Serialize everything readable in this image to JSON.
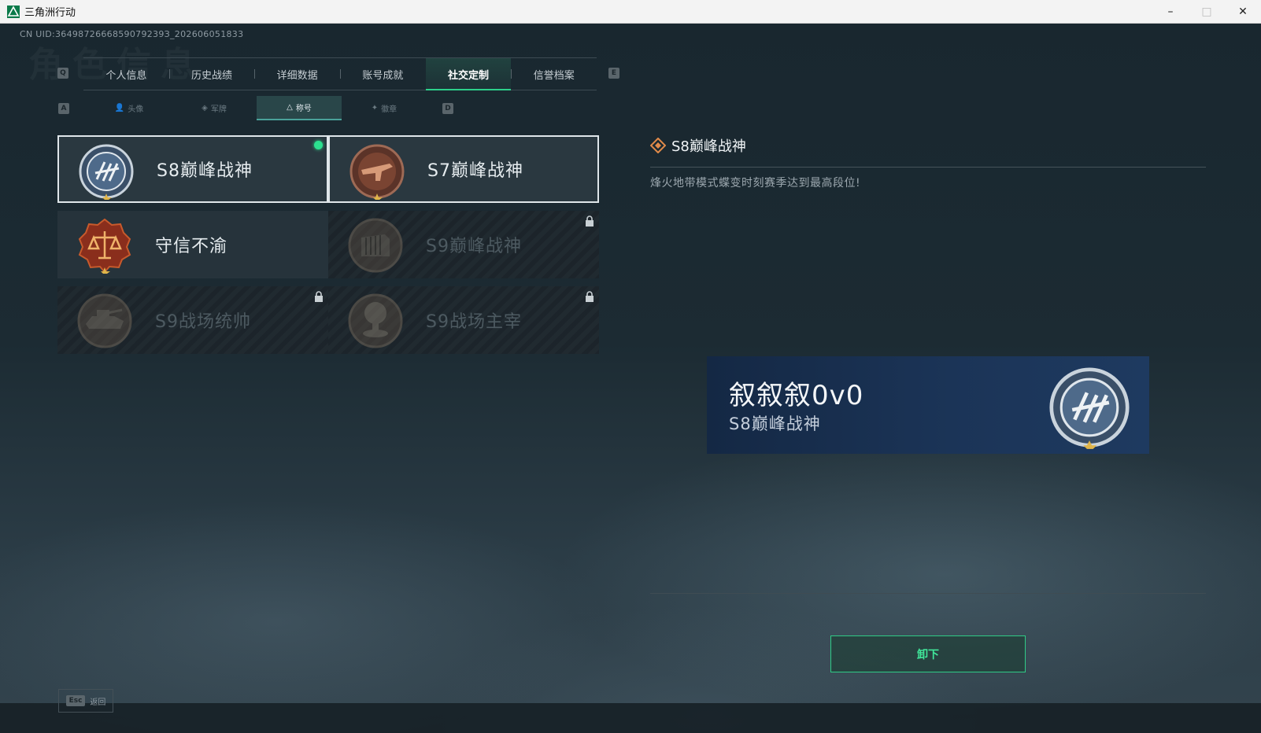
{
  "window": {
    "title": "三角洲行动",
    "min_glyph": "–",
    "max_glyph": "□",
    "close_glyph": "✕"
  },
  "uid": "CN UID:3649872666859079239З_202606051833",
  "page_watermark": "角色信息",
  "keys": {
    "tab_prev": "Q",
    "tab_next": "E",
    "sub_prev": "A",
    "sub_next": "D"
  },
  "tabs": [
    {
      "label": "个人信息"
    },
    {
      "label": "历史战绩"
    },
    {
      "label": "详细数据"
    },
    {
      "label": "账号成就"
    },
    {
      "label": "社交定制",
      "active": true
    },
    {
      "label": "信誉档案"
    }
  ],
  "subtabs": [
    {
      "label": "头像",
      "icon": "person-icon"
    },
    {
      "label": "军牌",
      "icon": "dogtag-icon"
    },
    {
      "label": "称号",
      "icon": "title-icon",
      "active": true
    },
    {
      "label": "徽章",
      "icon": "badge-icon"
    }
  ],
  "titles": [
    {
      "label": "S8巅峰战神",
      "emblem": "s8-emblem-icon",
      "state": "equipped"
    },
    {
      "label": "S7巅峰战神",
      "emblem": "s7-emblem-icon",
      "state": "selected"
    },
    {
      "label": "守信不渝",
      "emblem": "scales-emblem-icon",
      "state": "owned"
    },
    {
      "label": "S9巅峰战神",
      "emblem": "s9-emblem-icon",
      "state": "locked"
    },
    {
      "label": "S9战场统帅",
      "emblem": "tank-emblem-icon",
      "state": "locked"
    },
    {
      "label": "S9战场主宰",
      "emblem": "explosion-emblem-icon",
      "state": "locked"
    }
  ],
  "detail": {
    "title": "S8巅峰战神",
    "description": "烽火地带模式蝶变时刻赛季达到最高段位!"
  },
  "namecard": {
    "player_name": "叙叙叙0v0",
    "title": "S8巅峰战神"
  },
  "unequip_label": "卸下",
  "footer": {
    "esc_key": "Esc",
    "back_label": "返回"
  },
  "colors": {
    "accent_green": "#2dd08a",
    "equipped_dot": "#2ce08f",
    "namecard_bg": "#1b3457"
  }
}
